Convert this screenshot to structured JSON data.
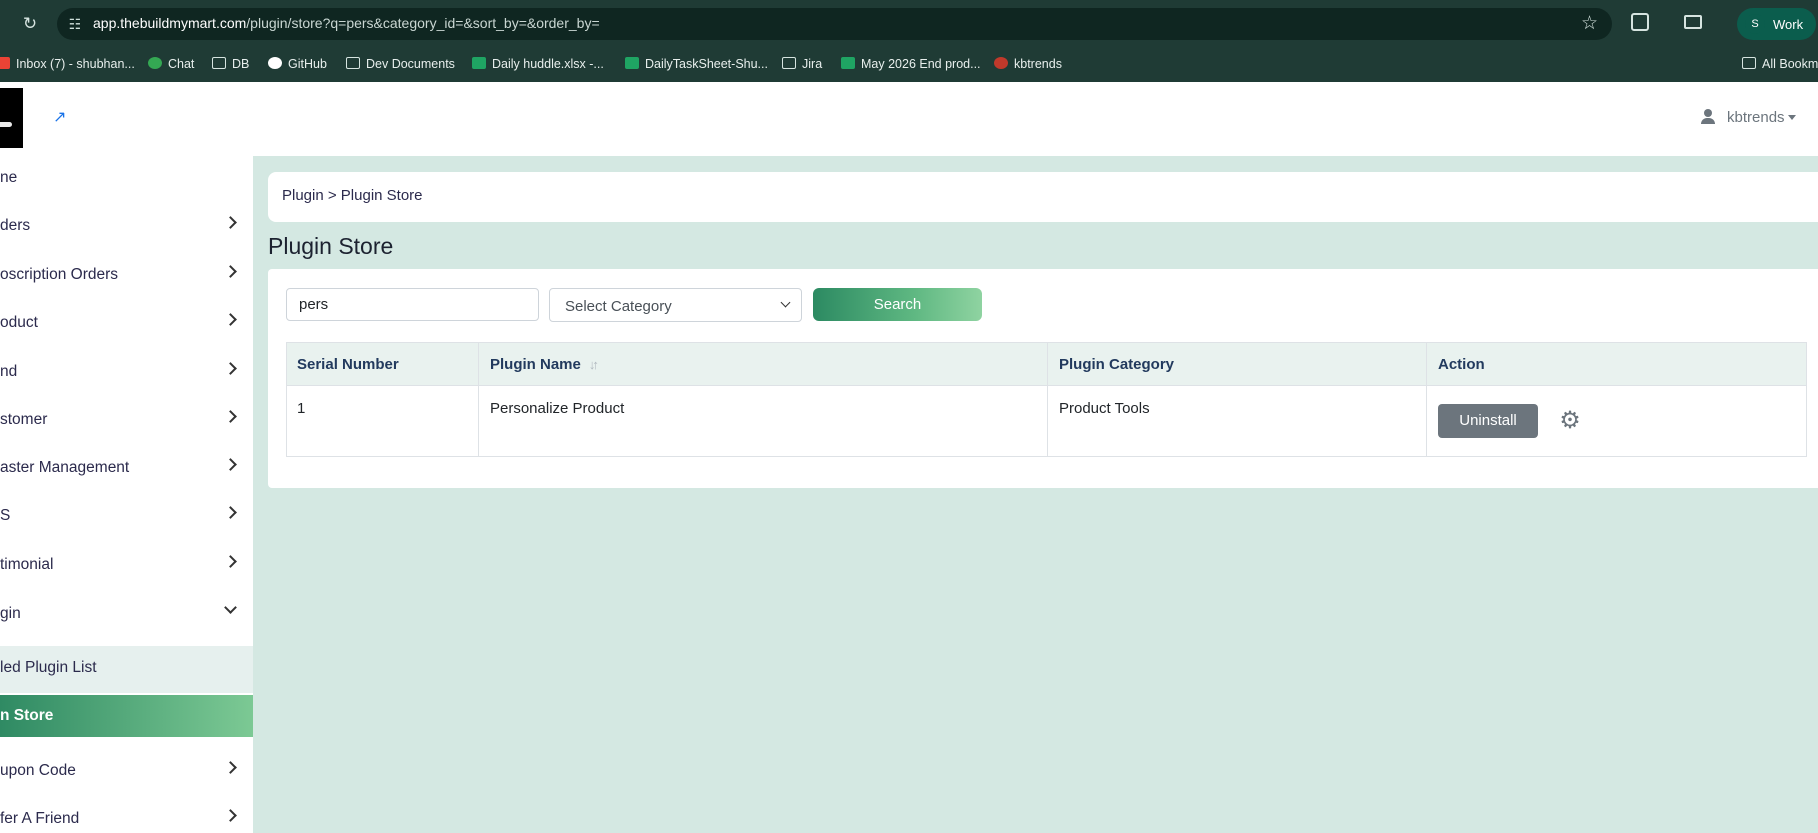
{
  "browser": {
    "url_host": "app.thebuildmymart.com",
    "url_path": "/plugin/store?q=pers&category_id=&sort_by=&order_by=",
    "profile_initial": "S",
    "profile_label": "Work"
  },
  "bookmarks": [
    {
      "label": "Inbox (7) - shubhan...",
      "icon": "gmail-icon"
    },
    {
      "label": "Chat",
      "icon": "chat-icon"
    },
    {
      "label": "DB",
      "icon": "folder-icon"
    },
    {
      "label": "GitHub",
      "icon": "github-icon"
    },
    {
      "label": "Dev Documents",
      "icon": "folder-icon"
    },
    {
      "label": "Daily huddle.xlsx -...",
      "icon": "sheets-icon"
    },
    {
      "label": "DailyTaskSheet-Shu...",
      "icon": "sheets-icon"
    },
    {
      "label": "Jira",
      "icon": "folder-icon"
    },
    {
      "label": "May 2026 End prod...",
      "icon": "sheets-icon"
    },
    {
      "label": "kbtrends",
      "icon": "kbtrends-icon"
    },
    {
      "label": "All Bookm",
      "icon": "folder-icon"
    }
  ],
  "header": {
    "user_name": "kbtrends"
  },
  "sidebar": {
    "items": [
      {
        "label": "ne",
        "has_chevron": false
      },
      {
        "label": "ders",
        "has_chevron": true
      },
      {
        "label": "oscription Orders",
        "has_chevron": true
      },
      {
        "label": "oduct",
        "has_chevron": true
      },
      {
        "label": "nd",
        "has_chevron": true
      },
      {
        "label": "stomer",
        "has_chevron": true
      },
      {
        "label": "aster Management",
        "has_chevron": true
      },
      {
        "label": "S",
        "has_chevron": true
      },
      {
        "label": "timonial",
        "has_chevron": true
      },
      {
        "label": "gin",
        "has_chevron": true,
        "expanded": true
      },
      {
        "label": "led Plugin List",
        "has_chevron": false
      },
      {
        "label": "n Store",
        "has_chevron": false,
        "active": true
      },
      {
        "label": "upon Code",
        "has_chevron": true
      },
      {
        "label": "fer A Friend",
        "has_chevron": true
      }
    ]
  },
  "main": {
    "breadcrumb": "Plugin > Plugin Store",
    "page_title": "Plugin Store",
    "search": {
      "value": "pers",
      "category_placeholder": "Select Category",
      "button_label": "Search"
    },
    "table": {
      "columns": [
        "Serial Number",
        "Plugin Name",
        "Plugin Category",
        "Action"
      ],
      "rows": [
        {
          "serial": "1",
          "name": "Personalize Product",
          "category": "Product Tools",
          "action_label": "Uninstall"
        }
      ]
    }
  },
  "colors": {
    "browser_chrome": "#1f3b35",
    "content_bg": "#d4e8e2",
    "accent_green": "#2f8a63",
    "uninstall_gray": "#6c757d"
  }
}
